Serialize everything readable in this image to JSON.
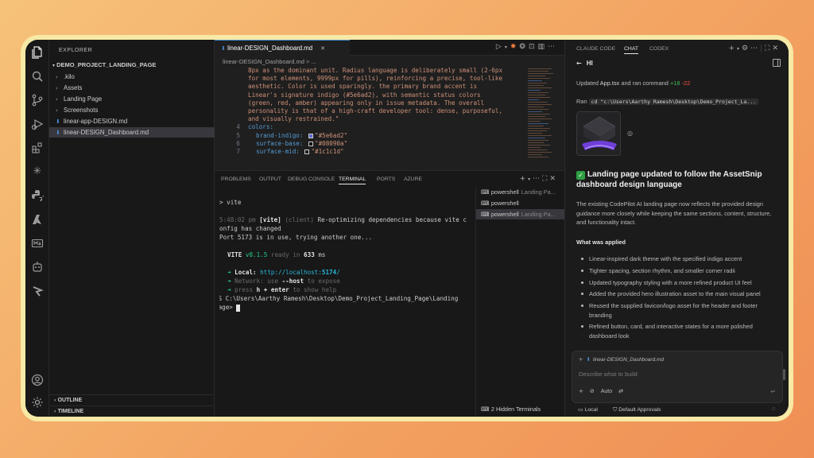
{
  "explorer": {
    "title": "EXPLORER",
    "root": "DEMO_PROJECT_LANDING_PAGE",
    "items": [
      {
        "label": ".kilo",
        "type": "folder"
      },
      {
        "label": "Assets",
        "type": "folder"
      },
      {
        "label": "Landing Page",
        "type": "folder"
      },
      {
        "label": "Screenshots",
        "type": "folder"
      },
      {
        "label": "linear-app-DESIGN.md",
        "type": "file"
      },
      {
        "label": "linear-DESIGN_Dashboard.md",
        "type": "file",
        "selected": true
      }
    ],
    "outline": "OUTLINE",
    "timeline": "TIMELINE"
  },
  "editor": {
    "tab": "linear-DESIGN_Dashboard.md",
    "breadcrumb": "linear-DESIGN_Dashboard.md > ...",
    "lines": [
      {
        "n": "",
        "text": "8px as the dominant unit. Radius language is deliberately small (2-6px"
      },
      {
        "n": "",
        "text": "for most elements, 9999px for pills), reinforcing a precise, tool-like"
      },
      {
        "n": "",
        "text": "aesthetic. Color is used sparingly. the primary brand accent is"
      },
      {
        "n": "",
        "text": "Linear's signature indigo (#5e6ad2), with semantic status colors"
      },
      {
        "n": "",
        "text": "(green, red, amber) appearing only in issue metadata. The overall"
      },
      {
        "n": "",
        "text": "personality is that of a high-craft developer tool: dense, purposeful,"
      },
      {
        "n": "",
        "text": "and visually restrained.\""
      }
    ],
    "colors_key": "colors:",
    "color_rows": [
      {
        "n": "5",
        "key": "brand-indigo:",
        "value": "\"#5e6ad2\"",
        "swatch": "#5e6ad2"
      },
      {
        "n": "6",
        "key": "surface-base:",
        "value": "\"#08090a\"",
        "swatch": "#08090a"
      },
      {
        "n": "7",
        "key": "surface-mid:",
        "value": "\"#1c1c1d\"",
        "swatch": "#1c1c1d"
      }
    ],
    "colors_line_n": "4"
  },
  "panel": {
    "tabs": [
      "PROBLEMS",
      "OUTPUT",
      "DEBUG CONSOLE",
      "TERMINAL",
      "PORTS",
      "AZURE"
    ],
    "active_tab": "TERMINAL",
    "terminal": {
      "l1": "> vite",
      "l2_time": "5:48:02 pm",
      "l2_tag": "[vite]",
      "l2_client": "(client)",
      "l2_msg": "Re-optimizing dependencies because vite c",
      "l3": "onfig has changed",
      "l4": "Port 5173 is in use, trying another one...",
      "vite_name": "VITE",
      "vite_ver": "v8.1.5",
      "ready": "ready in",
      "ready_ms": "633",
      "ms": "ms",
      "local_label": "Local:",
      "local_url_pre": "http://localhost:",
      "local_port": "5174",
      "local_url_post": "/",
      "network_label": "Network:",
      "network_text": "use",
      "network_flag": "--host",
      "network_tail": "to expose",
      "help_pre": "press",
      "help_key": "h + enter",
      "help_tail": "to show help",
      "prompt1": "PS C:\\Users\\Aarthy Ramesh\\Desktop\\Demo_Project_Landing_Page\\Landing",
      "prompt2": "Page>"
    },
    "terminals": [
      {
        "name": "powershell",
        "sub": "Landing Pa..."
      },
      {
        "name": "powershell",
        "sub": ""
      },
      {
        "name": "powershell",
        "sub": "Landing Pa...",
        "selected": true
      }
    ],
    "hidden": "2 Hidden Terminals"
  },
  "chat": {
    "tabs": [
      "CLAUDE CODE",
      "CHAT",
      "CODEX"
    ],
    "active_tab": "CHAT",
    "header": "HI",
    "updated_pre": "Updated",
    "updated_file": "App.tsx",
    "updated_mid": "and ran command",
    "added": "+18",
    "removed": "-22",
    "ran_label": "Ran",
    "ran_cmd": "cd \"c:\\Users\\Aarthy Ramesh\\Desktop\\Demo_Project_La...",
    "heading": "Landing page updated to follow the AssetSnip dashboard design language",
    "paragraph": "The existing CodePilot AI landing page now reflects the provided design guidance more closely while keeping the same sections, content, structure, and functionality intact.",
    "subheading": "What was applied",
    "bullets": [
      "Linear-inspired dark theme with the specified indigo accent",
      "Tighter spacing, section rhythm, and smaller corner radii",
      "Updated typography styling with a more refined product UI feel",
      "Added the provided hero illustration asset to the main visual panel",
      "Reused the supplied favicon/logo asset for the header and footer branding",
      "Refined button, card, and interactive states for a more polished dashboard look"
    ],
    "attachment": "linear-DESIGN_Dashboard.md",
    "placeholder": "Describe what to build",
    "mode": "Auto",
    "status_local": "Local",
    "status_approvals": "Default Approvals"
  },
  "colors": {
    "accent": "#4b8fd6",
    "check": "#2ea043",
    "added": "#3fb950",
    "removed": "#f85149"
  }
}
